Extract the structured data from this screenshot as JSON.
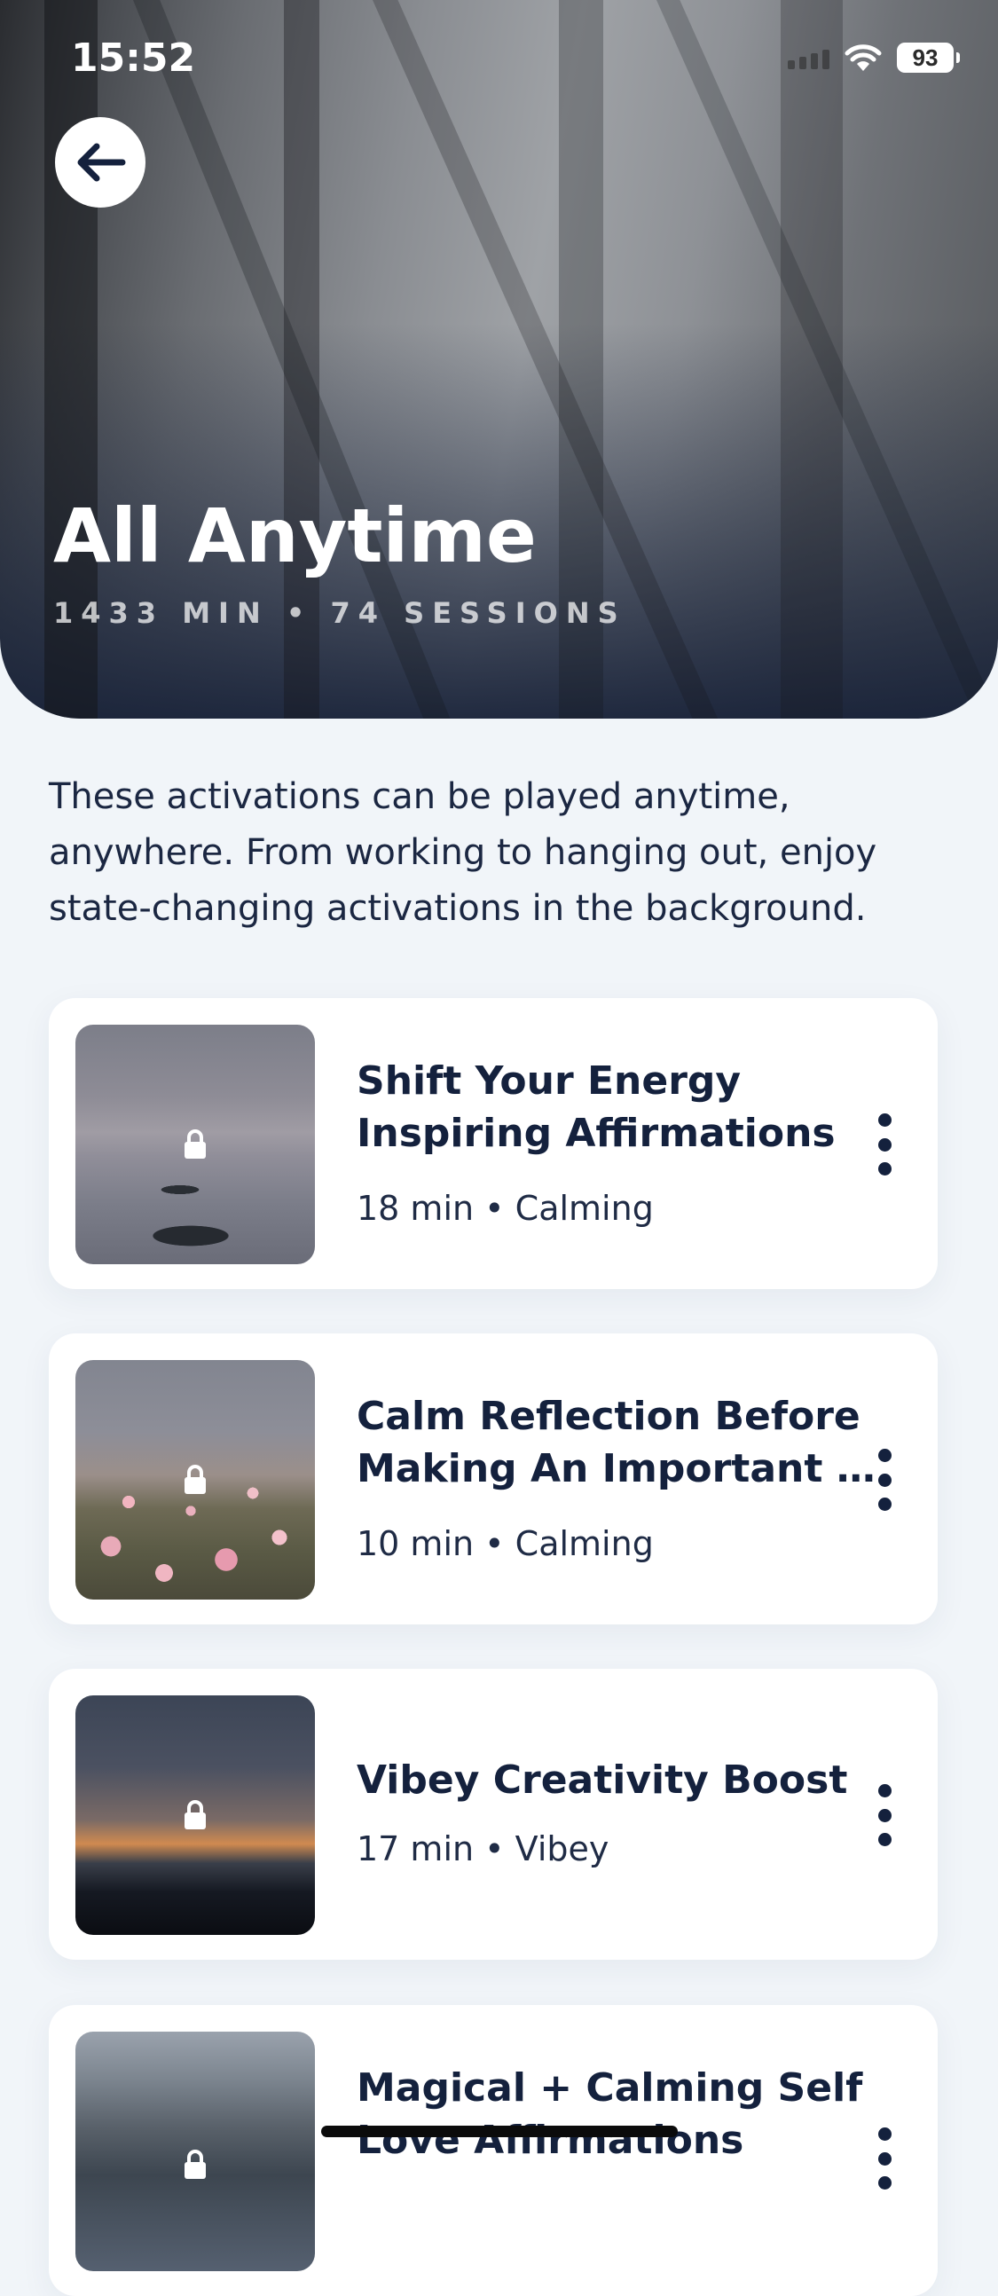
{
  "status_bar": {
    "time": "15:52",
    "battery": "93"
  },
  "header": {
    "title": "All Anytime",
    "meta": "1433 MIN • 74 SESSIONS"
  },
  "description": "These activations can be played anytime, anywhere. From working to hanging out, enjoy state-changing activations in the background.",
  "sessions": [
    {
      "title_line1": "Shift Your Energy",
      "title_line2": "Inspiring Affirmations",
      "meta": "18 min • Calming",
      "locked": true
    },
    {
      "title_line1": "Calm Reflection Before",
      "title_line2": "Making An Important D...",
      "meta": "10 min • Calming",
      "locked": true
    },
    {
      "title_line1": "Vibey Creativity Boost",
      "title_line2": "",
      "meta": "17 min • Vibey",
      "locked": true
    },
    {
      "title_line1": "Magical + Calming Self",
      "title_line2": "Love Affirmations",
      "meta": "",
      "locked": true
    }
  ]
}
